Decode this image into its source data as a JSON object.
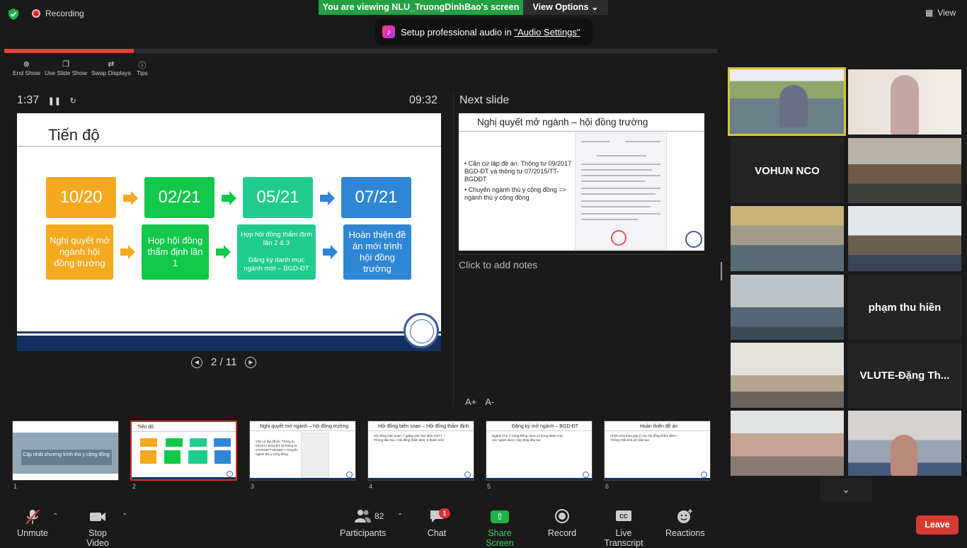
{
  "top": {
    "recording": "Recording",
    "viewing_banner": "You are viewing NLU_TruongDinhBao's screen",
    "view_options": "View Options",
    "audio_tip_prefix": "Setup professional audio in ",
    "audio_tip_link": "\"Audio Settings\"",
    "view": "View"
  },
  "progress": {
    "fraction": 0.182
  },
  "presenter_tools": [
    "End Show",
    "Use Slide Show",
    "Swap Displays",
    "Tips"
  ],
  "timer": "1:37",
  "clock": "09:32",
  "next_slide_label": "Next slide",
  "current_slide": {
    "title": "Tiến độ",
    "dates": [
      "10/20",
      "02/21",
      "05/21",
      "07/21"
    ],
    "date_colors": [
      "#f4a81e",
      "#12c84a",
      "#1fcc8e",
      "#2f86d4"
    ],
    "captions": [
      "Nghị quyết mở ngành hội đồng trường",
      "Họp hội đồng thẩm định lần 1",
      "Họp hội đồng thẩm định lần 2 & 3\n\nĐăng ký danh mục ngành mới – BGD-ĐT",
      "Hoàn thiện đề án mới trình hội đồng trường"
    ]
  },
  "pager": "2 / 11",
  "next_slide": {
    "title": "Nghị quyết mở ngành – hội đồng trường",
    "bullet1": "Căn cứ lập đề án: Thông tư 09/2017 BGD-ĐT và thông tư 07/2015/TT-BGDĐT",
    "bullet2": "Chuyển ngành thú y cộng đồng => ngành thú y cộng đồng"
  },
  "notes_placeholder": "Click to add notes",
  "font_buttons": [
    "A+",
    "A-"
  ],
  "thumbnails": [
    {
      "num": "1",
      "title": "Cập nhật chương trình thú y cộng đồng",
      "text": ""
    },
    {
      "num": "2",
      "title": "Tiến độ",
      "text": ""
    },
    {
      "num": "3",
      "title": "Nghị quyết mở ngành – hội đồng trường",
      "text": "Căn cứ lập đề án: Thông tư 09/2017 BGD-ĐT và thông tư 07/2015/TT-BGDĐT • Chuyển ngành thú y cộng đồng"
    },
    {
      "num": "4",
      "title": "Hội đồng biên soạn – Hội đồng thẩm định",
      "text": "Hội đồng biên soạn: 7 giảng viên Đại diện CNTY + Phòng đào tạo • Hội đồng thẩm định: 5 thành viên"
    },
    {
      "num": "5",
      "title": "Đăng ký mở ngành – BGD-ĐT",
      "text": "Ngành Thú Y Cộng Đồng chưa có trong danh mục các ngành được cấp phép đào tạo"
    },
    {
      "num": "6",
      "title": "Hoàn thiện đề án",
      "text": "Chỉnh sửa theo góp ý của Hội đồng thẩm định • Thống nhất tỉnh phí đào tạo"
    }
  ],
  "participants": [
    {
      "name": ""
    },
    {
      "name": ""
    },
    {
      "name": "VOHUN NCO"
    },
    {
      "name": ""
    },
    {
      "name": ""
    },
    {
      "name": ""
    },
    {
      "name": ""
    },
    {
      "name": "phạm thu hiền"
    },
    {
      "name": ""
    },
    {
      "name": "VLUTE-Đặng Th..."
    },
    {
      "name": ""
    },
    {
      "name": ""
    }
  ],
  "controls": {
    "unmute": "Unmute",
    "stop_video": "Stop Video",
    "participants": "Participants",
    "participants_count": "82",
    "chat": "Chat",
    "chat_badge": "1",
    "share": "Share Screen",
    "record": "Record",
    "transcript": "Live Transcript",
    "reactions": "Reactions",
    "leave": "Leave"
  }
}
